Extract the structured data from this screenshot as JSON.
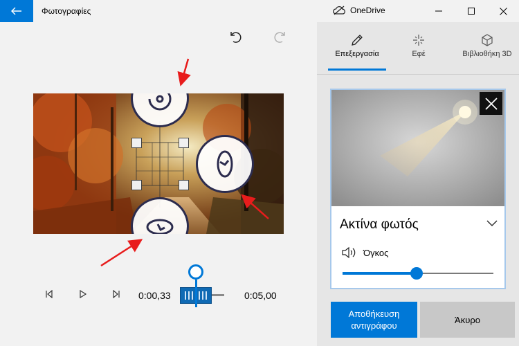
{
  "titlebar": {
    "app_title": "Φωτογραφίες",
    "onedrive_label": "OneDrive",
    "accent": "#0078d7"
  },
  "icons": {
    "back": "back-arrow-icon",
    "cloud": "cloud-icon",
    "minimize": "minimize-icon",
    "maximize": "maximize-icon",
    "close": "close-icon",
    "undo": "undo-icon",
    "redo": "redo-icon"
  },
  "player": {
    "current_time": "0:00,33",
    "total_time": "0:05,00",
    "position": 0.066
  },
  "tabs": [
    {
      "label": "Επεξεργασία",
      "icon": "pencil-icon",
      "active": true
    },
    {
      "label": "Εφέ",
      "icon": "sparkle-icon",
      "active": false
    },
    {
      "label": "Βιβλιοθήκη 3D",
      "icon": "cube-icon",
      "active": false
    }
  ],
  "effect": {
    "name": "Ακτίνα φωτός",
    "volume_label": "Όγκος",
    "volume_level": 0.49
  },
  "buttons": {
    "save": "Αποθήκευση αντιγράφου",
    "cancel": "Άκυρο"
  }
}
